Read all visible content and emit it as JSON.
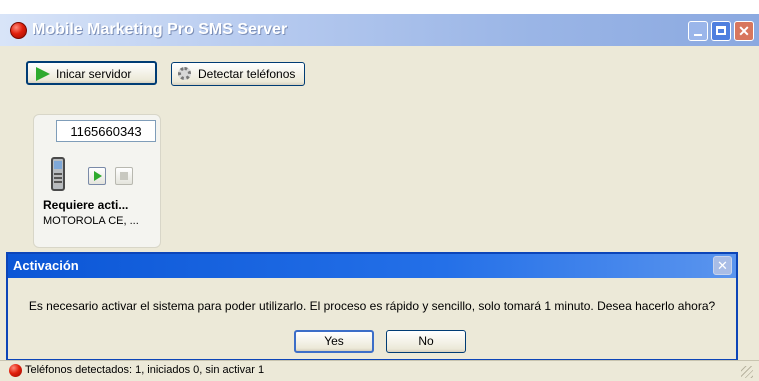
{
  "window": {
    "title": "Mobile Marketing Pro SMS Server",
    "controls": {
      "minimize": "_",
      "maximize": "□",
      "close": "✕"
    }
  },
  "toolbar": {
    "start_label": "Inicar servidor",
    "start_icon": "play-icon",
    "detect_label": "Detectar teléfonos",
    "detect_icon": "gear-icon"
  },
  "device": {
    "phone_number": "1165660343",
    "status": "Requiere acti...",
    "model": "MOTOROLA CE, ...",
    "icon": "mobile-phone-icon"
  },
  "dialog": {
    "title": "Activación",
    "message": "Es necesario activar el sistema para poder utilizarlo. El proceso es rápido y sencillo, solo tomará 1 minuto. Desea hacerlo ahora?",
    "yes_label": "Yes",
    "no_label": "No",
    "close": "✕"
  },
  "statusbar": {
    "text": "Teléfonos detectados: 1,  iniciados 0, sin activar 1"
  },
  "colors": {
    "titlebar_accent": "#8ba9e0",
    "dialog_title": "#0b56d6",
    "status_red": "#e01f0c",
    "play_green": "#2eaa2e"
  }
}
